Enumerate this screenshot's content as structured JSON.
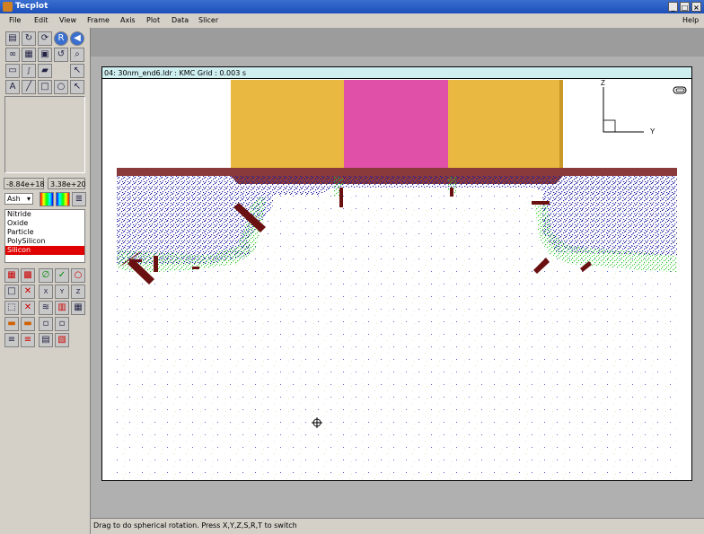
{
  "window": {
    "title": "Tecplot",
    "buttons": [
      "_",
      "□",
      "×"
    ]
  },
  "menu": {
    "items": [
      "File",
      "Edit",
      "View",
      "Frame",
      "Axis",
      "Plot",
      "Data",
      "Slicer"
    ],
    "help": "Help"
  },
  "toolbar_icons": [
    "open-icon",
    "redraw-icon",
    "rotate-icon",
    "reset-icon",
    "back-icon",
    "link-icon",
    "grid-icon",
    "grid2-icon",
    "rotate3d-icon",
    "zoom-icon",
    "text-icon",
    "integral-icon",
    "probe-icon",
    "pointer-icon",
    "letter-a-icon",
    "line-icon",
    "rectangle-icon",
    "ellipse-icon",
    "select-icon"
  ],
  "range": {
    "min": "-8.84e+18",
    "max": "3.38e+20"
  },
  "colormap": {
    "selected": "Ash"
  },
  "materials": [
    "Nitride",
    "Oxide",
    "Particle",
    "PolySilicon",
    "Silicon"
  ],
  "selected_material": "Silicon",
  "frame": {
    "header": "04: 30nm_end6.ldr : KMC Grid : 0.003 s"
  },
  "axes": {
    "z": "Z",
    "y": "Y"
  },
  "status": {
    "text": "Drag to do spherical rotation.  Press X,Y,Z,S,R,T to switch"
  },
  "colors": {
    "gate_side": "#e8b840",
    "gate_center": "#e050a8",
    "oxide": "#8a3a3a",
    "dopant": "#1a1aa0",
    "interstitial": "#30d030",
    "defect": "#6a1010"
  }
}
